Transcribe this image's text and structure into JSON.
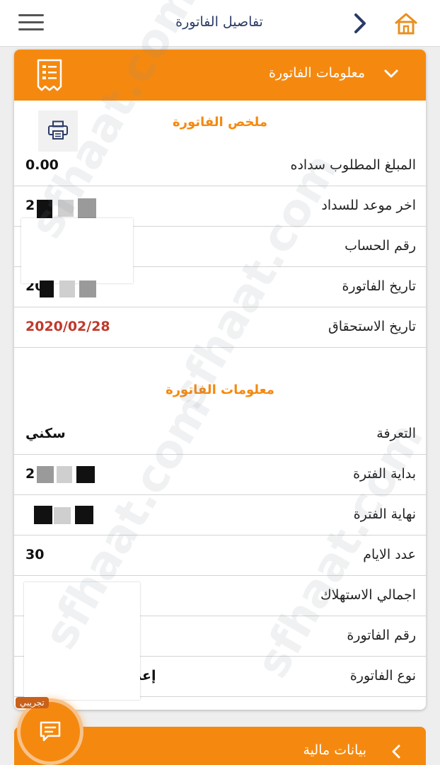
{
  "header": {
    "title": "تفاصيل الفاتورة",
    "menu_icon": "hamburger-menu-icon",
    "back_icon": "chevron-right-icon",
    "home_icon": "home-icon"
  },
  "invoice_card": {
    "header_title": "معلومات الفاتورة",
    "icon": "invoice-receipt-icon"
  },
  "summary": {
    "title": "ملخص الفاتورة",
    "print_icon": "printer-icon",
    "rows": [
      {
        "label": "المبلغ المطلوب سداده",
        "value": "0.00"
      },
      {
        "label": "اخر موعد للسداد",
        "value": "2"
      },
      {
        "label": "رقم الحساب",
        "value": ""
      },
      {
        "label": "تاريخ الفاتورة",
        "value": "20"
      },
      {
        "label": "تاريخ الاستحقاق",
        "value": "2020/02/28"
      }
    ]
  },
  "details": {
    "title": "معلومات الفاتورة",
    "rows": [
      {
        "label": "التعرفة",
        "value": "سكني"
      },
      {
        "label": "بداية الفترة",
        "value": "2"
      },
      {
        "label": "نهاية الفترة",
        "value": ""
      },
      {
        "label": "عدد الايام",
        "value": "30"
      },
      {
        "label": "اجمالي الاستهلاك",
        "value": ""
      },
      {
        "label": "رقم الفاتورة",
        "value": ""
      },
      {
        "label": "نوع الفاتورة",
        "value": "إعد"
      }
    ]
  },
  "bottom_section": {
    "title": "بيانات مالية",
    "icon": "chevron-left-icon"
  },
  "chat": {
    "badge": "تجريبي",
    "icon": "chat-bubble-icon"
  },
  "watermark": {
    "text": "sfhaat.com"
  },
  "colors": {
    "accent": "#f5890f",
    "due_date": "#c0392b",
    "title_text": "#2b3a67"
  }
}
